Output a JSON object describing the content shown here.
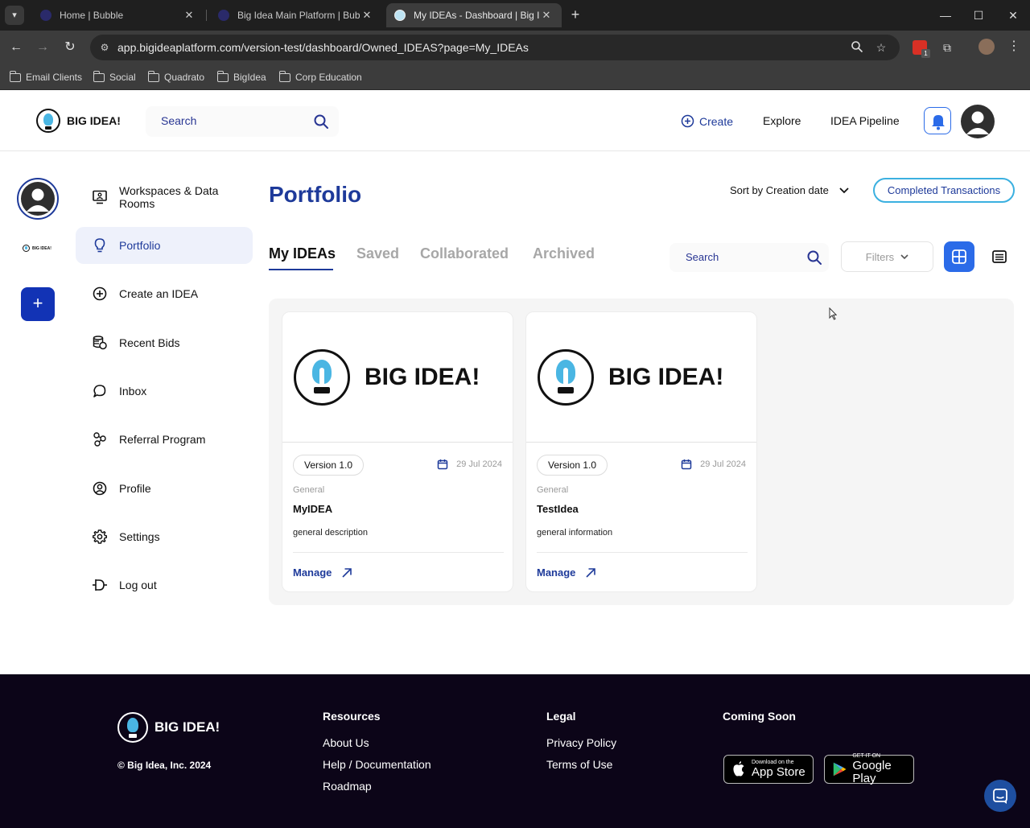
{
  "browser": {
    "tabs": [
      {
        "title": "Home | Bubble",
        "active": false
      },
      {
        "title": "Big Idea Main Platform | Bubble",
        "active": false
      },
      {
        "title": "My IDEAs - Dashboard | Big Idea",
        "active": true
      }
    ],
    "url": "app.bigideaplatform.com/version-test/dashboard/Owned_IDEAS?page=My_IDEAs",
    "bookmarks": [
      "Email Clients",
      "Social",
      "Quadrato",
      "BigIdea",
      "Corp Education"
    ],
    "extension_badge": "1"
  },
  "header": {
    "logo_text": "BIG IDEA!",
    "search_placeholder": "Search",
    "nav": {
      "create": "Create",
      "explore": "Explore",
      "pipeline": "IDEA Pipeline"
    }
  },
  "rail": {
    "mini_logo_text": "BIG IDEA!",
    "plus": "+"
  },
  "sidebar": {
    "items": [
      {
        "label": "Workspaces & Data Rooms",
        "icon": "presentation-icon",
        "active": false
      },
      {
        "label": "Portfolio",
        "icon": "lightbulb-icon",
        "active": true
      },
      {
        "label": "Create an IDEA",
        "icon": "plus-circle-icon",
        "active": false
      },
      {
        "label": "Recent Bids",
        "icon": "coins-icon",
        "active": false
      },
      {
        "label": "Inbox",
        "icon": "chat-icon",
        "active": false
      },
      {
        "label": "Referral Program",
        "icon": "referral-icon",
        "active": false
      },
      {
        "label": "Profile",
        "icon": "user-circle-icon",
        "active": false
      },
      {
        "label": "Settings",
        "icon": "gear-icon",
        "active": false
      },
      {
        "label": "Log out",
        "icon": "logout-icon",
        "active": false
      }
    ]
  },
  "main": {
    "title": "Portfolio",
    "sort_label": "Sort by Creation date",
    "completed_button": "Completed Transactions",
    "tabs": [
      {
        "label": "My IDEAs",
        "active": true
      },
      {
        "label": "Saved",
        "active": false
      },
      {
        "label": "Collaborated",
        "active": false
      },
      {
        "label": "Archived",
        "active": false
      }
    ],
    "search_placeholder": "Search",
    "filters_label": "Filters",
    "view_mode": "grid",
    "cards": [
      {
        "image_text": "BIG IDEA!",
        "version": "Version 1.0",
        "date": "29 Jul 2024",
        "category": "General",
        "name": "MyIDEA",
        "description": "general description",
        "action": "Manage"
      },
      {
        "image_text": "BIG IDEA!",
        "version": "Version 1.0",
        "date": "29 Jul 2024",
        "category": "General",
        "name": "TestIdea",
        "description": "general information",
        "action": "Manage"
      }
    ]
  },
  "footer": {
    "logo_text": "BIG IDEA!",
    "copyright": "© Big Idea, Inc. 2024",
    "resources": {
      "heading": "Resources",
      "links": [
        "About Us",
        "Help / Documentation",
        "Roadmap"
      ]
    },
    "legal": {
      "heading": "Legal",
      "links": [
        "Privacy Policy",
        "Terms of Use"
      ]
    },
    "coming_soon": {
      "heading": "Coming Soon",
      "app_store_small": "Download on the",
      "app_store_big": "App Store",
      "google_play_small": "GET IT ON",
      "google_play_big": "Google Play"
    }
  },
  "colors": {
    "brand_blue": "#1e3a9a",
    "accent_blue": "#2b6be8",
    "bulb_blue": "#4ab6e3",
    "footer_bg": "#0c0518"
  }
}
